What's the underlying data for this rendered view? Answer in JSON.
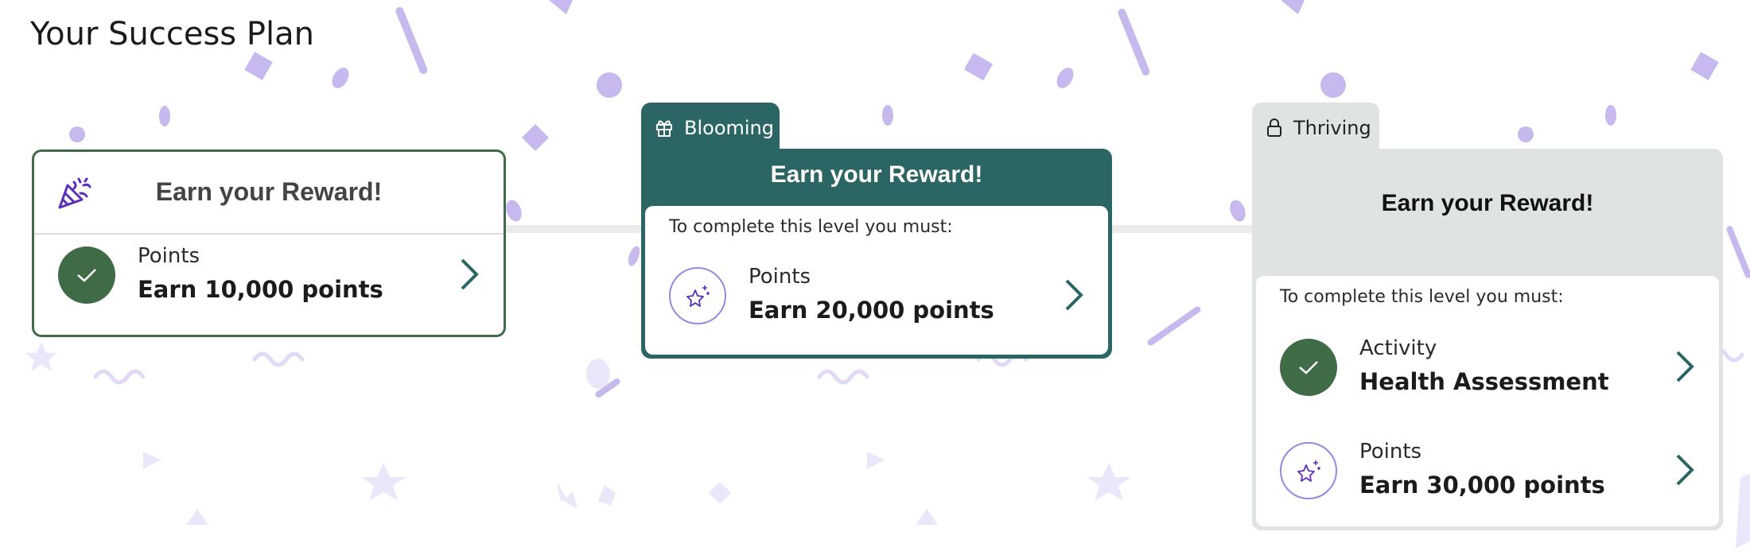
{
  "page": {
    "title": "Your Success Plan"
  },
  "colors": {
    "accent_teal": "#2c6664",
    "completed_green": "#3f6b47",
    "locked_gray": "#dfe4e2",
    "confetti_purple": "#c7b9ee",
    "icon_purple": "#5b2fb8"
  },
  "levels": [
    {
      "heading": "Earn your Reward!",
      "icon": "party-popper-icon",
      "items": [
        {
          "label": "Points",
          "value": "Earn 10,000 points",
          "status": "completed",
          "icon": "check-icon"
        }
      ]
    },
    {
      "tab": "Blooming",
      "tab_icon": "gift-icon",
      "heading": "Earn your Reward!",
      "intro": "To complete this level you must:",
      "items": [
        {
          "label": "Points",
          "value": "Earn 20,000 points",
          "status": "todo",
          "icon": "sparkles-star-icon"
        }
      ]
    },
    {
      "tab": "Thriving",
      "tab_icon": "lock-icon",
      "heading": "Earn your Reward!",
      "intro": "To complete this level you must:",
      "items": [
        {
          "label": "Activity",
          "value": "Health Assessment",
          "status": "completed",
          "icon": "check-icon"
        },
        {
          "label": "Points",
          "value": "Earn 30,000 points",
          "status": "todo",
          "icon": "sparkles-star-icon"
        }
      ]
    }
  ]
}
